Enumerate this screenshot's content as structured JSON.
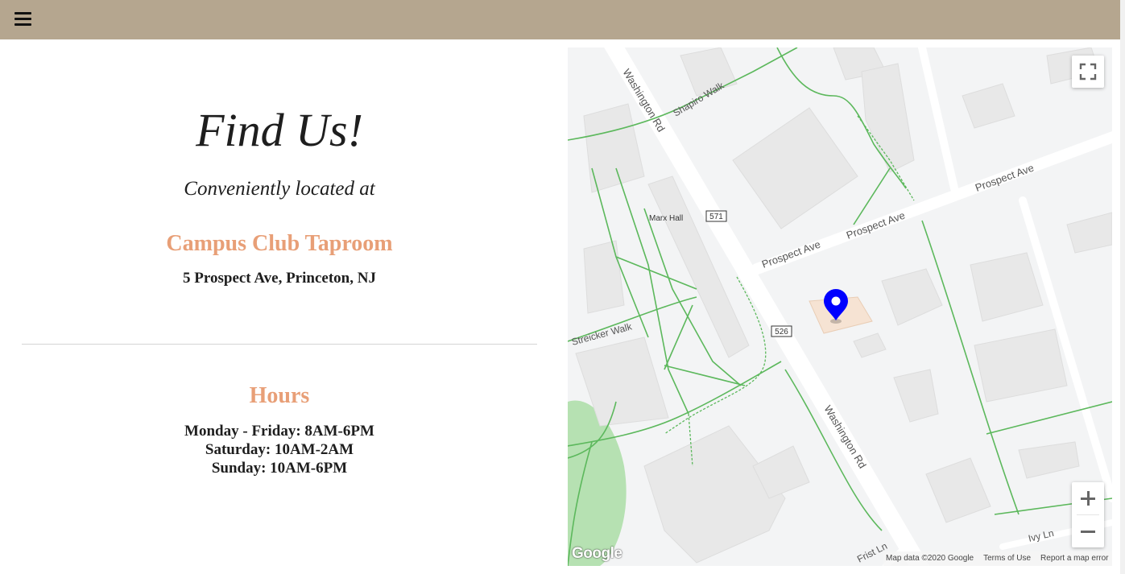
{
  "header": {
    "menu_icon": "hamburger-menu-icon"
  },
  "hero": {
    "title": "Find Us!",
    "subtitle": "Conveniently located at",
    "venue_name": "Campus Club Taproom",
    "address": "5 Prospect Ave, Princeton, NJ"
  },
  "hours": {
    "title": "Hours",
    "lines": [
      "Monday - Friday: 8AM-6PM",
      "Saturday: 10AM-2AM",
      "Sunday: 10AM-6PM"
    ]
  },
  "map": {
    "street_labels": {
      "washington_north": "Washington Rd",
      "washington_south": "Washington Rd",
      "shapiro": "Shapiro Walk",
      "prospect_left": "Prospect Ave",
      "prospect_mid": "Prospect Ave",
      "prospect_right": "Prospect Ave",
      "streicker": "Streicker Walk",
      "first": "Frist Ln",
      "ivy": "Ivy Ln"
    },
    "place_labels": {
      "marx_hall": "Marx Hall"
    },
    "route_shields": {
      "r571": "571",
      "r526": "526"
    },
    "logo": "Google",
    "footer": {
      "map_data": "Map data ©2020 Google",
      "terms": "Terms of Use",
      "report": "Report a map error"
    },
    "colors": {
      "marker": "#0000ff",
      "paths": "#5cb85c",
      "park": "#b6e1b2",
      "road": "#ffffff"
    },
    "icons": {
      "fullscreen": "fullscreen-icon",
      "zoom_in": "zoom-in-icon",
      "zoom_out": "zoom-out-icon",
      "marker": "map-marker-icon"
    }
  },
  "colors": {
    "header_bg": "#b5a68f",
    "accent": "#e89f77",
    "text": "#1e1e1e"
  }
}
